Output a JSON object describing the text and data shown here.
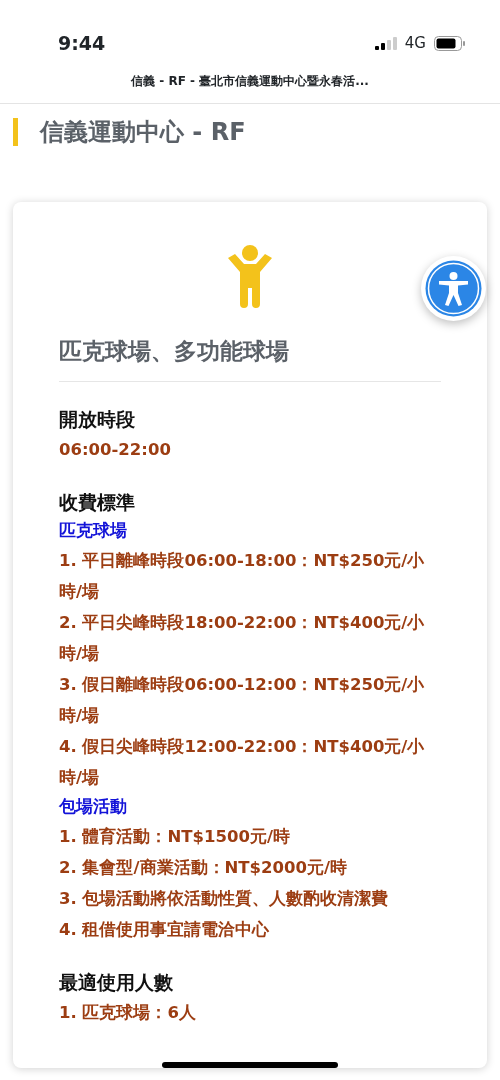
{
  "status_bar": {
    "time": "9:44",
    "network": "4G"
  },
  "browser_title": "信義 - RF - 臺北市信義運動中心暨永春活...",
  "page_title": "信義運動中心 - RF",
  "card": {
    "title": "匹克球場、多功能球場",
    "sections": [
      {
        "heading": "開放時段",
        "blocks": [
          {
            "kind": "item",
            "text": "06:00-22:00"
          }
        ]
      },
      {
        "heading": "收費標準",
        "blocks": [
          {
            "kind": "subheading",
            "text": "匹克球場"
          },
          {
            "kind": "item",
            "text": "1. 平日離峰時段06:00-18:00：NT$250元/小時/場"
          },
          {
            "kind": "item",
            "text": "2. 平日尖峰時段18:00-22:00：NT$400元/小時/場"
          },
          {
            "kind": "item",
            "text": "3. 假日離峰時段06:00-12:00：NT$250元/小時/場"
          },
          {
            "kind": "item",
            "text": "4. 假日尖峰時段12:00-22:00：NT$400元/小時/場"
          },
          {
            "kind": "subheading",
            "text": "包場活動"
          },
          {
            "kind": "item",
            "text": "1. 體育活動：NT$1500元/時"
          },
          {
            "kind": "item",
            "text": "2. 集會型/商業活動：NT$2000元/時"
          },
          {
            "kind": "item",
            "text": "3. 包場活動將依活動性質、人數酌收清潔費"
          },
          {
            "kind": "item",
            "text": "4. 租借使用事宜請電洽中心"
          }
        ]
      },
      {
        "heading": "最適使用人數",
        "blocks": [
          {
            "kind": "item",
            "text": "1. 匹克球場：6人"
          }
        ]
      }
    ]
  }
}
